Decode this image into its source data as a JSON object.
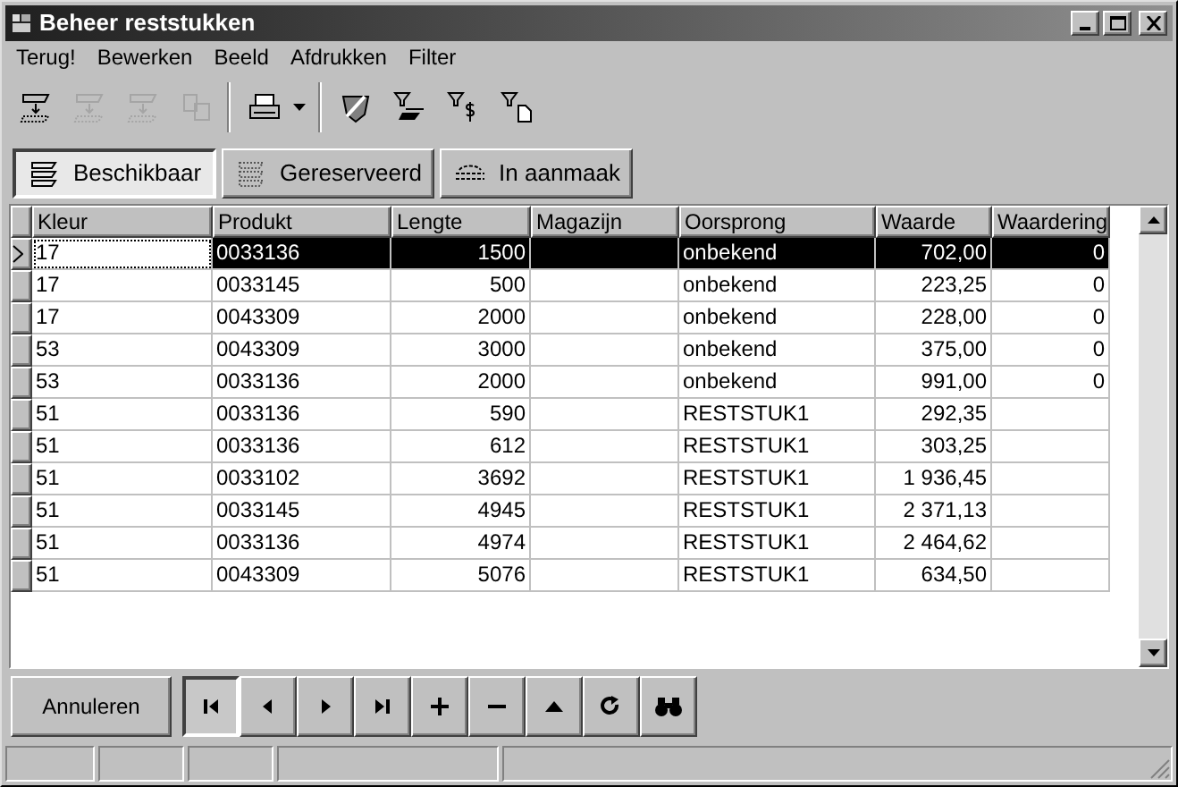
{
  "window": {
    "title": "Beheer reststukken"
  },
  "menu": [
    "Terug!",
    "Bewerken",
    "Beeld",
    "Afdrukken",
    "Filter"
  ],
  "toolbar": [
    {
      "kind": "down",
      "disabled": false
    },
    {
      "kind": "up",
      "disabled": true
    },
    {
      "kind": "updown",
      "disabled": true
    },
    {
      "kind": "copy",
      "disabled": true
    },
    {
      "kind": "print",
      "disabled": false
    },
    {
      "kind": "shield",
      "disabled": false
    },
    {
      "kind": "filter-stack",
      "disabled": false
    },
    {
      "kind": "filter-dollar",
      "disabled": false
    },
    {
      "kind": "filter-page",
      "disabled": false
    }
  ],
  "view_buttons": [
    {
      "label": "Beschikbaar",
      "selected": true
    },
    {
      "label": "Gereserveerd",
      "selected": false
    },
    {
      "label": "In aanmaak",
      "selected": false
    }
  ],
  "table": {
    "columns": [
      "Kleur",
      "Produkt",
      "Lengte",
      "Magazijn",
      "Oorsprong",
      "Waarde",
      "Waardering"
    ],
    "rows": [
      {
        "selected": true,
        "cells": [
          "17",
          "0033136",
          "1500",
          "",
          "onbekend",
          "702,00",
          "0"
        ]
      },
      {
        "selected": false,
        "cells": [
          "17",
          "0033145",
          "500",
          "",
          "onbekend",
          "223,25",
          "0"
        ]
      },
      {
        "selected": false,
        "cells": [
          "17",
          "0043309",
          "2000",
          "",
          "onbekend",
          "228,00",
          "0"
        ]
      },
      {
        "selected": false,
        "cells": [
          "53",
          "0043309",
          "3000",
          "",
          "onbekend",
          "375,00",
          "0"
        ]
      },
      {
        "selected": false,
        "cells": [
          "53",
          "0033136",
          "2000",
          "",
          "onbekend",
          "991,00",
          "0"
        ]
      },
      {
        "selected": false,
        "cells": [
          "51",
          "0033136",
          "590",
          "",
          "RESTSTUK1",
          "292,35",
          ""
        ]
      },
      {
        "selected": false,
        "cells": [
          "51",
          "0033136",
          "612",
          "",
          "RESTSTUK1",
          "303,25",
          ""
        ]
      },
      {
        "selected": false,
        "cells": [
          "51",
          "0033102",
          "3692",
          "",
          "RESTSTUK1",
          "1 936,45",
          ""
        ]
      },
      {
        "selected": false,
        "cells": [
          "51",
          "0033145",
          "4945",
          "",
          "RESTSTUK1",
          "2 371,13",
          ""
        ]
      },
      {
        "selected": false,
        "cells": [
          "51",
          "0033136",
          "4974",
          "",
          "RESTSTUK1",
          "2 464,62",
          ""
        ]
      },
      {
        "selected": false,
        "cells": [
          "51",
          "0043309",
          "5076",
          "",
          "RESTSTUK1",
          "634,50",
          ""
        ]
      }
    ]
  },
  "cancel_button": "Annuleren",
  "navigator": [
    {
      "kind": "first",
      "pressed": true
    },
    {
      "kind": "prior",
      "pressed": false
    },
    {
      "kind": "next",
      "pressed": false
    },
    {
      "kind": "last",
      "pressed": false
    },
    {
      "kind": "insert",
      "pressed": false
    },
    {
      "kind": "delete",
      "pressed": false
    },
    {
      "kind": "post",
      "pressed": false
    },
    {
      "kind": "refresh",
      "pressed": false
    },
    {
      "kind": "find",
      "pressed": false
    }
  ]
}
